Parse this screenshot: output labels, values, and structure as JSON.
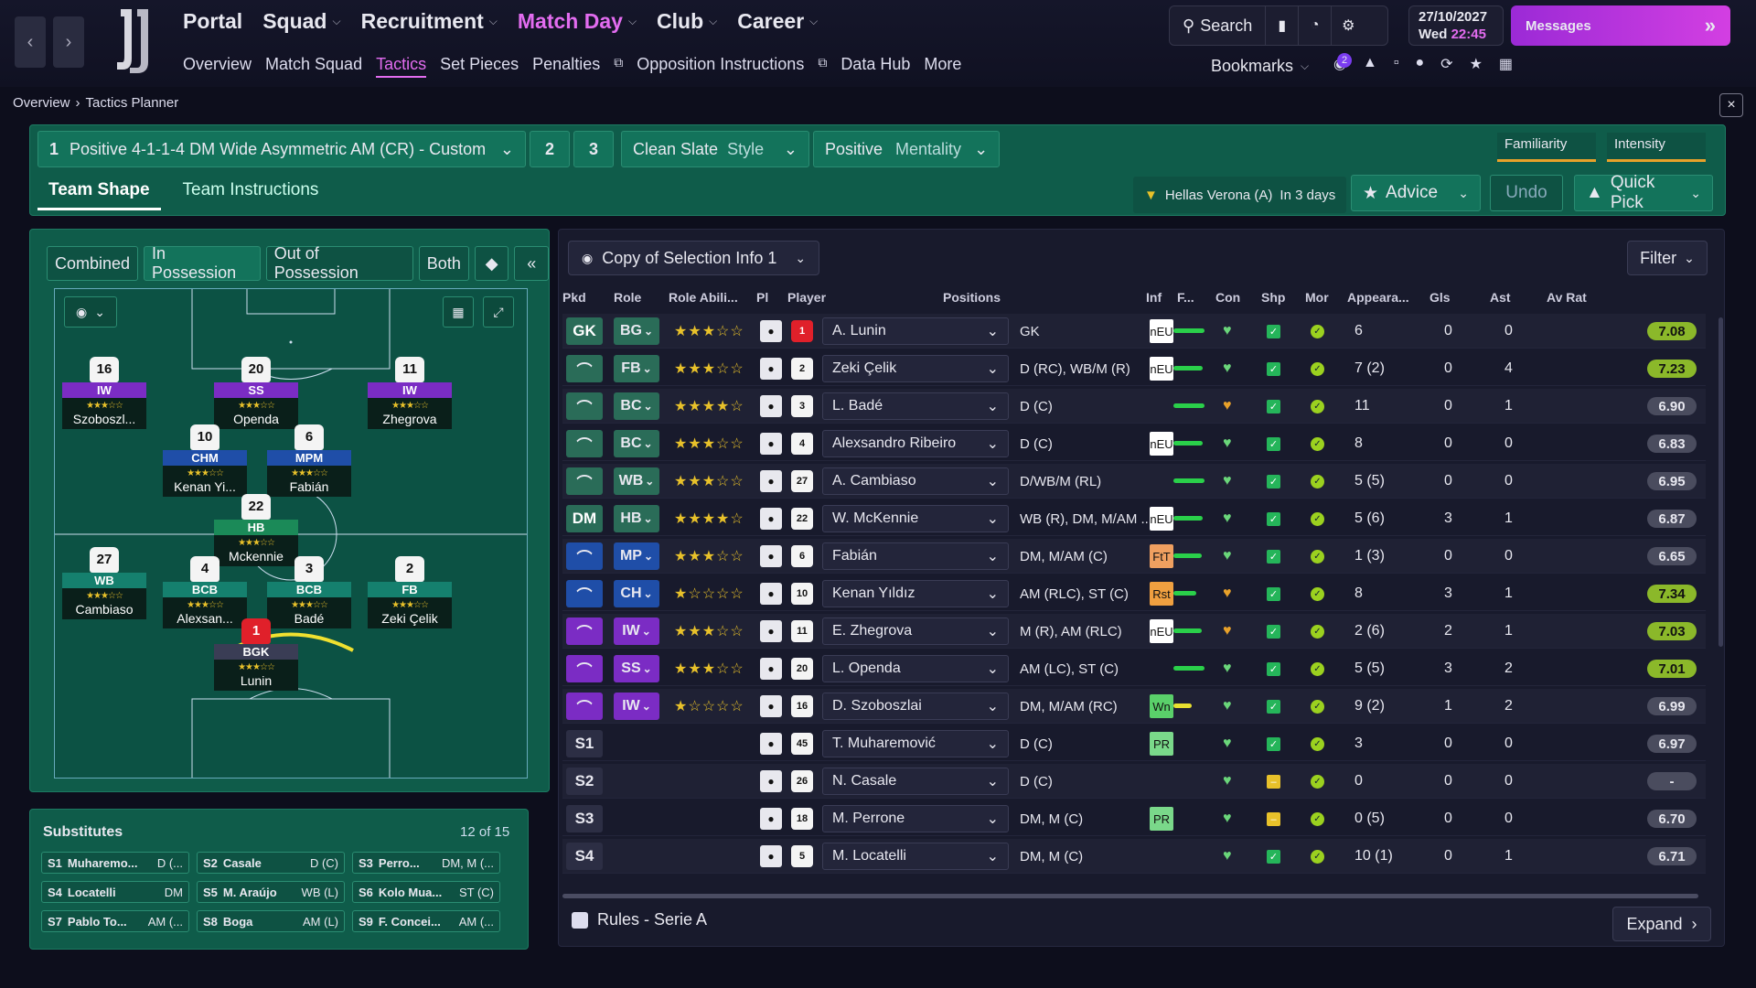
{
  "topbar": {
    "menu": [
      {
        "label": "Portal",
        "active": false
      },
      {
        "label": "Squad",
        "active": false
      },
      {
        "label": "Recruitment",
        "active": false
      },
      {
        "label": "Match Day",
        "active": true
      },
      {
        "label": "Club",
        "active": false
      },
      {
        "label": "Career",
        "active": false
      }
    ],
    "submenu": [
      "Overview",
      "Match Squad",
      "Tactics",
      "Set Pieces",
      "Penalties",
      "Opposition Instructions",
      "Data Hub",
      "More"
    ],
    "search": "Search",
    "date": "27/10/2027",
    "day": "Wed",
    "time": "22:45",
    "messages": "Messages",
    "bookmarks": "Bookmarks",
    "notif_count": "2"
  },
  "breadcrumb": {
    "root": "Overview",
    "current": "Tactics Planner"
  },
  "tactic": {
    "slot1_num": "1",
    "slot1_name": "Positive 4-1-1-4 DM Wide Asymmetric AM (CR) - Custom",
    "slot2": "2",
    "slot3": "3",
    "style_value": "Clean Slate",
    "style_label": "Style",
    "mentality_value": "Positive",
    "mentality_label": "Mentality",
    "familiarity": "Familiarity",
    "intensity": "Intensity",
    "tab_shape": "Team Shape",
    "tab_instructions": "Team Instructions",
    "fixture_team": "Hellas Verona (A)",
    "fixture_when": "In 3 days",
    "advice": "Advice",
    "undo": "Undo",
    "quick_pick": "Quick Pick"
  },
  "pitch_tabs": [
    "Combined",
    "In Possession",
    "Out of Possession",
    "Both"
  ],
  "pitch_players": [
    {
      "num": "16",
      "role": "IW",
      "name": "Szoboszl...",
      "color": "purple"
    },
    {
      "num": "20",
      "role": "SS",
      "name": "Openda",
      "color": "purple"
    },
    {
      "num": "11",
      "role": "IW",
      "name": "Zhegrova",
      "color": "purple"
    },
    {
      "num": "10",
      "role": "CHM",
      "name": "Kenan Yi...",
      "color": "blue"
    },
    {
      "num": "6",
      "role": "MPM",
      "name": "Fabián",
      "color": "blue"
    },
    {
      "num": "22",
      "role": "HB",
      "name": "Mckennie",
      "color": "green"
    },
    {
      "num": "27",
      "role": "WB",
      "name": "Cambiaso",
      "color": "teal"
    },
    {
      "num": "4",
      "role": "BCB",
      "name": "Alexsan...",
      "color": "teal"
    },
    {
      "num": "3",
      "role": "BCB",
      "name": "Badé",
      "color": "teal"
    },
    {
      "num": "2",
      "role": "FB",
      "name": "Zeki Çelik",
      "color": "teal"
    },
    {
      "num": "1",
      "role": "BGK",
      "name": "Lunin",
      "color": "grey"
    }
  ],
  "subs": {
    "title": "Substitutes",
    "count": "12 of 15",
    "items": [
      {
        "slot": "S1",
        "name": "Muharemo...",
        "pos": "D (..."
      },
      {
        "slot": "S2",
        "name": "Casale",
        "pos": "D (C)"
      },
      {
        "slot": "S3",
        "name": "Perro...",
        "pos": "DM, M (..."
      },
      {
        "slot": "S4",
        "name": "Locatelli",
        "pos": "DM"
      },
      {
        "slot": "S5",
        "name": "M. Araújo",
        "pos": "WB (L)"
      },
      {
        "slot": "S6",
        "name": "Kolo Mua...",
        "pos": "ST (C)"
      },
      {
        "slot": "S7",
        "name": "Pablo To...",
        "pos": "AM (..."
      },
      {
        "slot": "S8",
        "name": "Boga",
        "pos": "AM (L)"
      },
      {
        "slot": "S9",
        "name": "F. Conc​ei...",
        "pos": "AM (..."
      }
    ]
  },
  "table": {
    "selection": "Copy of Selection Info 1",
    "filter": "Filter",
    "headers": [
      "Pkd",
      "Role",
      "Role Abili...",
      "Pl",
      "Player",
      "Positions",
      "Inf",
      "F...",
      "Con",
      "Shp",
      "Mor",
      "Appeara...",
      "Gls",
      "Ast",
      "Av Rat"
    ],
    "rows": [
      {
        "pkd": "GK",
        "pk": "gk",
        "role": "BG",
        "stars": 3,
        "shirt": "1",
        "name": "A. Lunin",
        "pos": "GK",
        "inf": "nEU",
        "infc": "#ffffff",
        "fit": 0.95,
        "app": "6",
        "gls": "0",
        "ast": "0",
        "rat": "7.08",
        "g": true
      },
      {
        "pkd": "",
        "pk": "df",
        "role": "FB",
        "stars": 2.5,
        "shirt": "2",
        "name": "Zeki Çelik",
        "pos": "D (RC), WB/M (R)",
        "inf": "nEU",
        "infc": "#ffffff",
        "fit": 0.9,
        "app": "7 (2)",
        "gls": "0",
        "ast": "4",
        "rat": "7.23",
        "g": true
      },
      {
        "pkd": "",
        "pk": "df",
        "role": "BC",
        "stars": 3.5,
        "shirt": "3",
        "name": "L. Badé",
        "pos": "D (C)",
        "inf": "",
        "infc": "",
        "fit": 0.95,
        "app": "11",
        "gls": "0",
        "ast": "1",
        "rat": "6.90",
        "g": false
      },
      {
        "pkd": "",
        "pk": "df",
        "role": "BC",
        "stars": 3,
        "shirt": "4",
        "name": "Alexsandro Ribeiro",
        "pos": "D (C)",
        "inf": "nEU",
        "infc": "#ffffff",
        "fit": 0.9,
        "app": "8",
        "gls": "0",
        "ast": "0",
        "rat": "6.83",
        "g": false
      },
      {
        "pkd": "",
        "pk": "df",
        "role": "WB",
        "stars": 3,
        "shirt": "27",
        "name": "A. Cambiaso",
        "pos": "D/WB/M (RL)",
        "inf": "",
        "infc": "",
        "fit": 0.95,
        "app": "5 (5)",
        "gls": "0",
        "ast": "0",
        "rat": "6.95",
        "g": false
      },
      {
        "pkd": "DM",
        "pk": "dm",
        "role": "HB",
        "stars": 3.5,
        "shirt": "22",
        "name": "W. McKennie",
        "pos": "WB (R), DM, M/AM ...",
        "inf": "nEU",
        "infc": "#ffffff",
        "fit": 0.9,
        "app": "5 (6)",
        "gls": "3",
        "ast": "1",
        "rat": "6.87",
        "g": false
      },
      {
        "pkd": "",
        "pk": "mf",
        "role": "MP",
        "stars": 3,
        "shirt": "6",
        "name": "Fabián",
        "pos": "DM, M/AM (C)",
        "inf": "FtT",
        "infc": "#f0a060",
        "fit": 0.85,
        "app": "1 (3)",
        "gls": "0",
        "ast": "0",
        "rat": "6.65",
        "g": false
      },
      {
        "pkd": "",
        "pk": "mf",
        "role": "CH",
        "stars": 1,
        "shirt": "10",
        "name": "Kenan Yıldız",
        "pos": "AM (RLC), ST (C)",
        "inf": "Rst",
        "infc": "#f0a040",
        "fit": 0.7,
        "app": "8",
        "gls": "3",
        "ast": "1",
        "rat": "7.34",
        "g": true
      },
      {
        "pkd": "",
        "pk": "at",
        "role": "IW",
        "stars": 2.5,
        "shirt": "11",
        "name": "E. Zhegrova",
        "pos": "M (R), AM (RLC)",
        "inf": "nEU",
        "infc": "#ffffff",
        "fit": 0.85,
        "app": "2 (6)",
        "gls": "2",
        "ast": "1",
        "rat": "7.03",
        "g": true
      },
      {
        "pkd": "",
        "pk": "at",
        "role": "SS",
        "stars": 3,
        "shirt": "20",
        "name": "L. Openda",
        "pos": "AM (LC), ST (C)",
        "inf": "",
        "infc": "",
        "fit": 0.95,
        "app": "5 (5)",
        "gls": "3",
        "ast": "2",
        "rat": "7.01",
        "g": true
      },
      {
        "pkd": "",
        "pk": "at",
        "role": "IW",
        "stars": 1,
        "shirt": "16",
        "name": "D. Szoboszlai",
        "pos": "DM, M/AM (RC)",
        "inf": "Wn",
        "infc": "#5ad06a",
        "fit": 0.55,
        "app": "9 (2)",
        "gls": "1",
        "ast": "2",
        "rat": "6.99",
        "g": false
      },
      {
        "pkd": "S1",
        "pk": "sub",
        "role": "",
        "stars": 0,
        "shirt": "45",
        "name": "T. Muharemović",
        "pos": "D (C)",
        "inf": "PR",
        "infc": "#7ad88a",
        "fit": 0,
        "app": "3",
        "gls": "0",
        "ast": "0",
        "rat": "6.97",
        "g": false
      },
      {
        "pkd": "S2",
        "pk": "sub",
        "role": "",
        "stars": 0,
        "shirt": "26",
        "name": "N. Casale",
        "pos": "D (C)",
        "inf": "",
        "infc": "",
        "fit": 0,
        "app": "0",
        "gls": "0",
        "ast": "0",
        "rat": "-",
        "g": false
      },
      {
        "pkd": "S3",
        "pk": "sub",
        "role": "",
        "stars": 0,
        "shirt": "18",
        "name": "M. Perrone",
        "pos": "DM, M (C)",
        "inf": "PR",
        "infc": "#7ad88a",
        "fit": 0,
        "app": "0 (5)",
        "gls": "0",
        "ast": "0",
        "rat": "6.70",
        "g": false
      },
      {
        "pkd": "S4",
        "pk": "sub",
        "role": "",
        "stars": 0,
        "shirt": "5",
        "name": "M. Locatelli",
        "pos": "DM, M (C)",
        "inf": "",
        "infc": "",
        "fit": 0,
        "app": "10 (1)",
        "gls": "0",
        "ast": "1",
        "rat": "6.71",
        "g": false
      }
    ],
    "rules": "Rules - Serie A",
    "expand": "Expand"
  }
}
